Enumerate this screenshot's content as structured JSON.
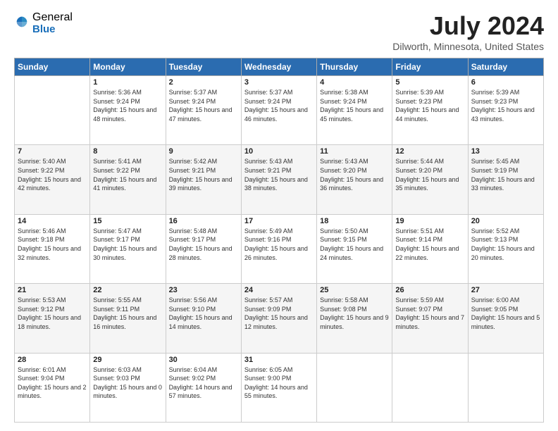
{
  "logo": {
    "general": "General",
    "blue": "Blue"
  },
  "title": {
    "month_year": "July 2024",
    "location": "Dilworth, Minnesota, United States"
  },
  "headers": [
    "Sunday",
    "Monday",
    "Tuesday",
    "Wednesday",
    "Thursday",
    "Friday",
    "Saturday"
  ],
  "weeks": [
    [
      {
        "date": "",
        "sunrise": "",
        "sunset": "",
        "daylight": ""
      },
      {
        "date": "1",
        "sunrise": "Sunrise: 5:36 AM",
        "sunset": "Sunset: 9:24 PM",
        "daylight": "Daylight: 15 hours and 48 minutes."
      },
      {
        "date": "2",
        "sunrise": "Sunrise: 5:37 AM",
        "sunset": "Sunset: 9:24 PM",
        "daylight": "Daylight: 15 hours and 47 minutes."
      },
      {
        "date": "3",
        "sunrise": "Sunrise: 5:37 AM",
        "sunset": "Sunset: 9:24 PM",
        "daylight": "Daylight: 15 hours and 46 minutes."
      },
      {
        "date": "4",
        "sunrise": "Sunrise: 5:38 AM",
        "sunset": "Sunset: 9:24 PM",
        "daylight": "Daylight: 15 hours and 45 minutes."
      },
      {
        "date": "5",
        "sunrise": "Sunrise: 5:39 AM",
        "sunset": "Sunset: 9:23 PM",
        "daylight": "Daylight: 15 hours and 44 minutes."
      },
      {
        "date": "6",
        "sunrise": "Sunrise: 5:39 AM",
        "sunset": "Sunset: 9:23 PM",
        "daylight": "Daylight: 15 hours and 43 minutes."
      }
    ],
    [
      {
        "date": "7",
        "sunrise": "Sunrise: 5:40 AM",
        "sunset": "Sunset: 9:22 PM",
        "daylight": "Daylight: 15 hours and 42 minutes."
      },
      {
        "date": "8",
        "sunrise": "Sunrise: 5:41 AM",
        "sunset": "Sunset: 9:22 PM",
        "daylight": "Daylight: 15 hours and 41 minutes."
      },
      {
        "date": "9",
        "sunrise": "Sunrise: 5:42 AM",
        "sunset": "Sunset: 9:21 PM",
        "daylight": "Daylight: 15 hours and 39 minutes."
      },
      {
        "date": "10",
        "sunrise": "Sunrise: 5:43 AM",
        "sunset": "Sunset: 9:21 PM",
        "daylight": "Daylight: 15 hours and 38 minutes."
      },
      {
        "date": "11",
        "sunrise": "Sunrise: 5:43 AM",
        "sunset": "Sunset: 9:20 PM",
        "daylight": "Daylight: 15 hours and 36 minutes."
      },
      {
        "date": "12",
        "sunrise": "Sunrise: 5:44 AM",
        "sunset": "Sunset: 9:20 PM",
        "daylight": "Daylight: 15 hours and 35 minutes."
      },
      {
        "date": "13",
        "sunrise": "Sunrise: 5:45 AM",
        "sunset": "Sunset: 9:19 PM",
        "daylight": "Daylight: 15 hours and 33 minutes."
      }
    ],
    [
      {
        "date": "14",
        "sunrise": "Sunrise: 5:46 AM",
        "sunset": "Sunset: 9:18 PM",
        "daylight": "Daylight: 15 hours and 32 minutes."
      },
      {
        "date": "15",
        "sunrise": "Sunrise: 5:47 AM",
        "sunset": "Sunset: 9:17 PM",
        "daylight": "Daylight: 15 hours and 30 minutes."
      },
      {
        "date": "16",
        "sunrise": "Sunrise: 5:48 AM",
        "sunset": "Sunset: 9:17 PM",
        "daylight": "Daylight: 15 hours and 28 minutes."
      },
      {
        "date": "17",
        "sunrise": "Sunrise: 5:49 AM",
        "sunset": "Sunset: 9:16 PM",
        "daylight": "Daylight: 15 hours and 26 minutes."
      },
      {
        "date": "18",
        "sunrise": "Sunrise: 5:50 AM",
        "sunset": "Sunset: 9:15 PM",
        "daylight": "Daylight: 15 hours and 24 minutes."
      },
      {
        "date": "19",
        "sunrise": "Sunrise: 5:51 AM",
        "sunset": "Sunset: 9:14 PM",
        "daylight": "Daylight: 15 hours and 22 minutes."
      },
      {
        "date": "20",
        "sunrise": "Sunrise: 5:52 AM",
        "sunset": "Sunset: 9:13 PM",
        "daylight": "Daylight: 15 hours and 20 minutes."
      }
    ],
    [
      {
        "date": "21",
        "sunrise": "Sunrise: 5:53 AM",
        "sunset": "Sunset: 9:12 PM",
        "daylight": "Daylight: 15 hours and 18 minutes."
      },
      {
        "date": "22",
        "sunrise": "Sunrise: 5:55 AM",
        "sunset": "Sunset: 9:11 PM",
        "daylight": "Daylight: 15 hours and 16 minutes."
      },
      {
        "date": "23",
        "sunrise": "Sunrise: 5:56 AM",
        "sunset": "Sunset: 9:10 PM",
        "daylight": "Daylight: 15 hours and 14 minutes."
      },
      {
        "date": "24",
        "sunrise": "Sunrise: 5:57 AM",
        "sunset": "Sunset: 9:09 PM",
        "daylight": "Daylight: 15 hours and 12 minutes."
      },
      {
        "date": "25",
        "sunrise": "Sunrise: 5:58 AM",
        "sunset": "Sunset: 9:08 PM",
        "daylight": "Daylight: 15 hours and 9 minutes."
      },
      {
        "date": "26",
        "sunrise": "Sunrise: 5:59 AM",
        "sunset": "Sunset: 9:07 PM",
        "daylight": "Daylight: 15 hours and 7 minutes."
      },
      {
        "date": "27",
        "sunrise": "Sunrise: 6:00 AM",
        "sunset": "Sunset: 9:05 PM",
        "daylight": "Daylight: 15 hours and 5 minutes."
      }
    ],
    [
      {
        "date": "28",
        "sunrise": "Sunrise: 6:01 AM",
        "sunset": "Sunset: 9:04 PM",
        "daylight": "Daylight: 15 hours and 2 minutes."
      },
      {
        "date": "29",
        "sunrise": "Sunrise: 6:03 AM",
        "sunset": "Sunset: 9:03 PM",
        "daylight": "Daylight: 15 hours and 0 minutes."
      },
      {
        "date": "30",
        "sunrise": "Sunrise: 6:04 AM",
        "sunset": "Sunset: 9:02 PM",
        "daylight": "Daylight: 14 hours and 57 minutes."
      },
      {
        "date": "31",
        "sunrise": "Sunrise: 6:05 AM",
        "sunset": "Sunset: 9:00 PM",
        "daylight": "Daylight: 14 hours and 55 minutes."
      },
      {
        "date": "",
        "sunrise": "",
        "sunset": "",
        "daylight": ""
      },
      {
        "date": "",
        "sunrise": "",
        "sunset": "",
        "daylight": ""
      },
      {
        "date": "",
        "sunrise": "",
        "sunset": "",
        "daylight": ""
      }
    ]
  ]
}
